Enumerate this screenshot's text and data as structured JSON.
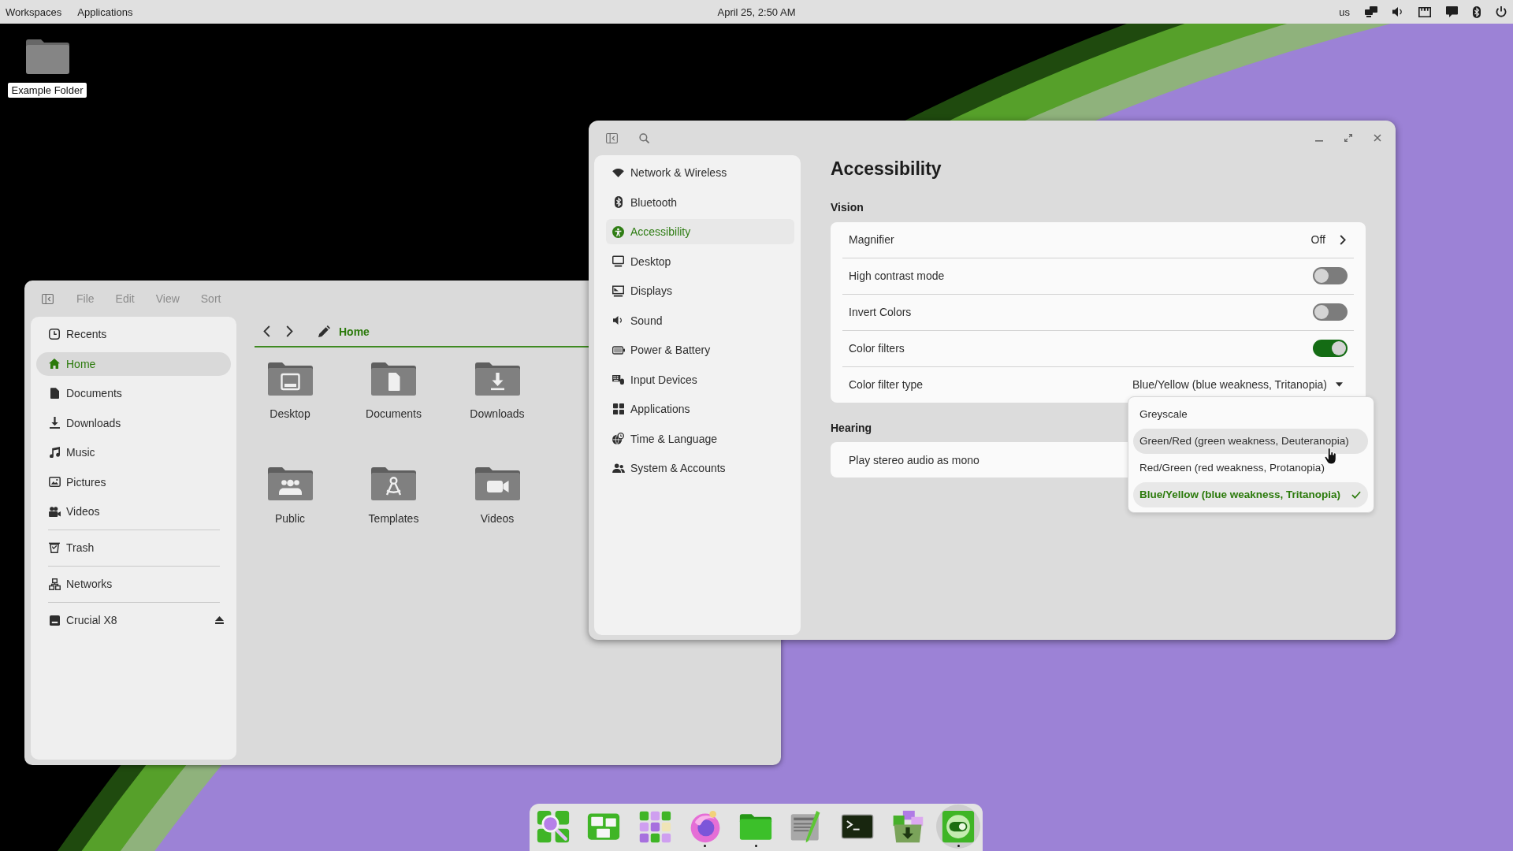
{
  "top_bar": {
    "workspaces": "Workspaces",
    "applications": "Applications",
    "clock": "April 25, 2:50 AM",
    "keyboard_layout": "us"
  },
  "desktop_icons": [
    {
      "label": "Example Folder"
    }
  ],
  "file_manager": {
    "menu": [
      "File",
      "Edit",
      "View",
      "Sort"
    ],
    "sidebar": [
      {
        "items": [
          {
            "label": "Recents",
            "selected": false,
            "ejectable": false
          },
          {
            "label": "Home",
            "selected": true,
            "ejectable": false
          },
          {
            "label": "Documents",
            "selected": false,
            "ejectable": false
          },
          {
            "label": "Downloads",
            "selected": false,
            "ejectable": false
          },
          {
            "label": "Music",
            "selected": false,
            "ejectable": false
          },
          {
            "label": "Pictures",
            "selected": false,
            "ejectable": false
          },
          {
            "label": "Videos",
            "selected": false,
            "ejectable": false
          }
        ]
      },
      {
        "items": [
          {
            "label": "Trash",
            "selected": false,
            "ejectable": false
          }
        ]
      },
      {
        "items": [
          {
            "label": "Networks",
            "selected": false,
            "ejectable": false
          }
        ]
      },
      {
        "items": [
          {
            "label": "Crucial X8",
            "selected": false,
            "ejectable": true
          }
        ]
      }
    ],
    "location": "Home",
    "folders": [
      {
        "label": "Desktop"
      },
      {
        "label": "Documents"
      },
      {
        "label": "Downloads"
      },
      {
        "label": "Public"
      },
      {
        "label": "Templates"
      },
      {
        "label": "Videos"
      }
    ]
  },
  "settings": {
    "sidebar": [
      {
        "label": "Network & Wireless",
        "selected": false
      },
      {
        "label": "Bluetooth",
        "selected": false
      },
      {
        "label": "Accessibility",
        "selected": true
      },
      {
        "label": "Desktop",
        "selected": false
      },
      {
        "label": "Displays",
        "selected": false
      },
      {
        "label": "Sound",
        "selected": false
      },
      {
        "label": "Power & Battery",
        "selected": false
      },
      {
        "label": "Input Devices",
        "selected": false
      },
      {
        "label": "Applications",
        "selected": false
      },
      {
        "label": "Time & Language",
        "selected": false
      },
      {
        "label": "System & Accounts",
        "selected": false
      }
    ],
    "title": "Accessibility",
    "sections": [
      {
        "heading": "Vision",
        "rows": [
          {
            "kind": "link",
            "label": "Magnifier",
            "value": "Off"
          },
          {
            "kind": "toggle",
            "label": "High contrast mode",
            "on": false
          },
          {
            "kind": "toggle",
            "label": "Invert Colors",
            "on": false
          },
          {
            "kind": "toggle",
            "label": "Color filters",
            "on": true
          },
          {
            "kind": "dropdown",
            "label": "Color filter type",
            "value": "Blue/Yellow (blue weakness, Tritanopia)",
            "expanded": true,
            "options": [
              {
                "label": "Greyscale",
                "selected": false,
                "hovered": false
              },
              {
                "label": "Green/Red (green weakness, Deuteranopia)",
                "selected": false,
                "hovered": true
              },
              {
                "label": "Red/Green (red weakness, Protanopia)",
                "selected": false,
                "hovered": false
              },
              {
                "label": "Blue/Yellow (blue weakness, Tritanopia)",
                "selected": true,
                "hovered": false
              }
            ]
          }
        ]
      },
      {
        "heading": "Hearing",
        "rows": [
          {
            "kind": "text",
            "label": "Play stereo audio as mono"
          }
        ]
      }
    ]
  },
  "dock": [
    {
      "running": false,
      "hovered": false
    },
    {
      "running": false,
      "hovered": false
    },
    {
      "running": false,
      "hovered": false
    },
    {
      "running": true,
      "hovered": false
    },
    {
      "running": true,
      "hovered": false
    },
    {
      "running": false,
      "hovered": false
    },
    {
      "running": false,
      "hovered": false
    },
    {
      "running": false,
      "hovered": false
    },
    {
      "running": true,
      "hovered": true
    }
  ]
}
